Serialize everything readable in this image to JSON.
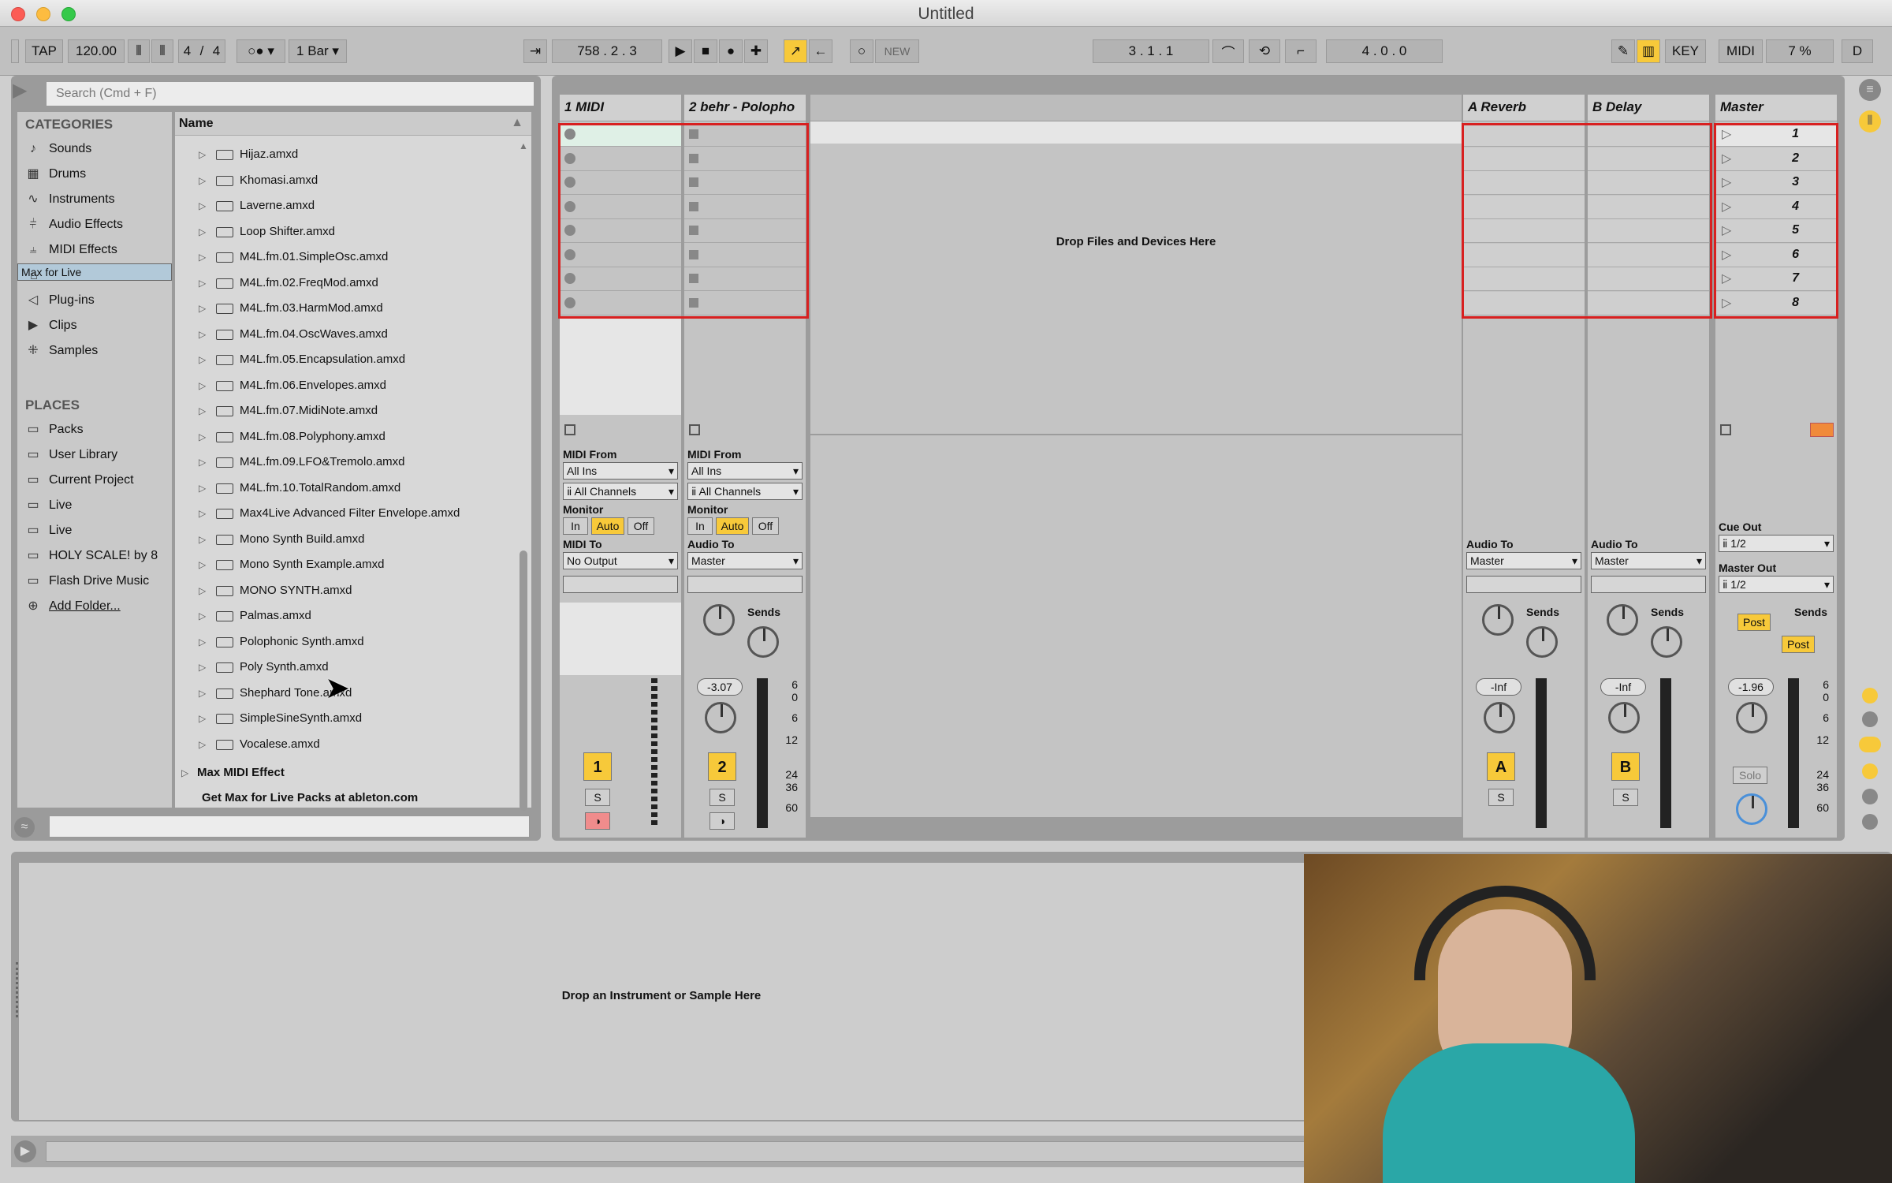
{
  "window": {
    "title": "Untitled"
  },
  "transport": {
    "tap": "TAP",
    "tempo": "120.00",
    "signature_num": "4",
    "signature_den": "4",
    "quantize": "1 Bar",
    "position": "758 .   2 .   3",
    "new_label": "NEW",
    "loop_start": "3 .   1 .   1",
    "loop_length": "4 .   0 .   0",
    "key_label": "KEY",
    "midi_label": "MIDI",
    "cpu": "7 %",
    "d_label": "D"
  },
  "browser": {
    "search_placeholder": "Search (Cmd + F)",
    "categories_heading": "CATEGORIES",
    "categories": [
      {
        "label": "Sounds",
        "icon": "music-note-icon"
      },
      {
        "label": "Drums",
        "icon": "drum-grid-icon"
      },
      {
        "label": "Instruments",
        "icon": "waveform-icon"
      },
      {
        "label": "Audio Effects",
        "icon": "sliders-icon"
      },
      {
        "label": "MIDI Effects",
        "icon": "midi-sliders-icon"
      },
      {
        "label": "Max for Live",
        "icon": "max-icon"
      },
      {
        "label": "Plug-ins",
        "icon": "plugin-icon"
      },
      {
        "label": "Clips",
        "icon": "clip-icon"
      },
      {
        "label": "Samples",
        "icon": "sample-wave-icon"
      }
    ],
    "places_heading": "PLACES",
    "places": [
      {
        "label": "Packs"
      },
      {
        "label": "User Library"
      },
      {
        "label": "Current Project"
      },
      {
        "label": "Live"
      },
      {
        "label": "Live"
      },
      {
        "label": "HOLY SCALE! by 8"
      },
      {
        "label": "Flash Drive Music"
      },
      {
        "label": "Add Folder..."
      }
    ],
    "column_name": "Name",
    "files": [
      "Hijaz.amxd",
      "Khomasi.amxd",
      "Laverne.amxd",
      "Loop Shifter.amxd",
      "M4L.fm.01.SimpleOsc.amxd",
      "M4L.fm.02.FreqMod.amxd",
      "M4L.fm.03.HarmMod.amxd",
      "M4L.fm.04.OscWaves.amxd",
      "M4L.fm.05.Encapsulation.amxd",
      "M4L.fm.06.Envelopes.amxd",
      "M4L.fm.07.MidiNote.amxd",
      "M4L.fm.08.Polyphony.amxd",
      "M4L.fm.09.LFO&Tremolo.amxd",
      "M4L.fm.10.TotalRandom.amxd",
      "Max4Live Advanced Filter Envelope.amxd",
      "Mono Synth Build.amxd",
      "Mono Synth Example.amxd",
      "MONO SYNTH.amxd",
      "Palmas.amxd",
      "Polophonic Synth.amxd",
      "Poly Synth.amxd",
      "Shephard Tone.amxd",
      "SimpleSineSynth.amxd",
      "Vocalese.amxd"
    ],
    "folder_label": "Max MIDI Effect",
    "get_packs": "Get  Max  for  Live  Packs  at  ableton.com"
  },
  "session": {
    "tracks": [
      {
        "name": "1 MIDI",
        "number": "1"
      },
      {
        "name": "2 behr - Polopho",
        "number": "2",
        "volume": "-3.07"
      }
    ],
    "returns": [
      {
        "name": "A Reverb",
        "letter": "A",
        "volume": "-Inf"
      },
      {
        "name": "B Delay",
        "letter": "B",
        "volume": "-Inf"
      }
    ],
    "master": {
      "name": "Master",
      "volume": "-1.96",
      "solo": "Solo"
    },
    "scenes": [
      "1",
      "2",
      "3",
      "4",
      "5",
      "6",
      "7",
      "8"
    ],
    "drop_text": "Drop Files and Devices Here",
    "midi_from": "MIDI From",
    "all_ins": "All Ins",
    "all_channels": "All Channels",
    "monitor": "Monitor",
    "mon_in": "In",
    "mon_auto": "Auto",
    "mon_off": "Off",
    "midi_to": "MIDI To",
    "no_output": "No Output",
    "audio_to": "Audio To",
    "master_route": "Master",
    "sends": "Sends",
    "send_a": "A",
    "send_b": "B",
    "s_label": "S",
    "cue_out": "Cue Out",
    "cue_val": "1/2",
    "master_out": "Master Out",
    "master_out_val": "1/2",
    "post": "Post",
    "scale": [
      "6",
      "0",
      "6",
      "12",
      "24",
      "36",
      "60"
    ],
    "scale_db": [
      "6",
      "0",
      "- 6",
      "- 12",
      "- 24",
      "- 36",
      "- 60"
    ]
  },
  "detail": {
    "drop_text": "Drop an Instrument or Sample Here"
  },
  "colors": {
    "accent": "#f7c93a",
    "selection": "#d82020",
    "arm": "#f08c8c"
  }
}
